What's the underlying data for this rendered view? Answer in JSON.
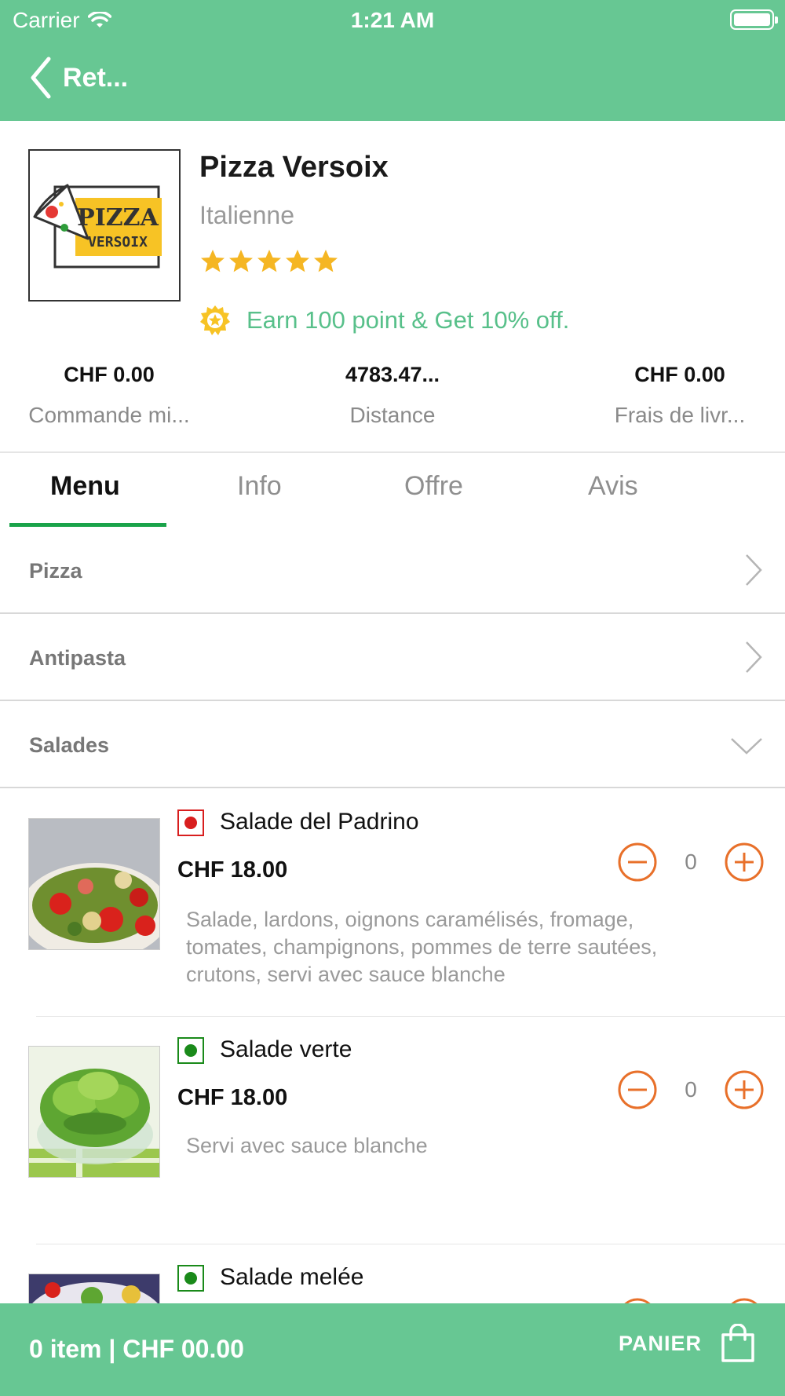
{
  "status_bar": {
    "carrier": "Carrier",
    "time": "1:21 AM"
  },
  "nav": {
    "back_label": "Ret..."
  },
  "restaurant": {
    "name": "Pizza Versoix",
    "cuisine": "Italienne",
    "rating": 5,
    "rating_max": 5,
    "promo": "Earn 100 point & Get 10% off.",
    "logo_text_1": "PIZZA",
    "logo_text_2": "VERSOIX"
  },
  "stats": [
    {
      "value": "CHF 0.00",
      "label": "Commande mi..."
    },
    {
      "value": "4783.47...",
      "label": "Distance"
    },
    {
      "value": "CHF 0.00",
      "label": "Frais de livr..."
    }
  ],
  "tabs": [
    {
      "label": "Menu",
      "active": true
    },
    {
      "label": "Info",
      "active": false
    },
    {
      "label": "Offre",
      "active": false
    },
    {
      "label": "Avis",
      "active": false
    }
  ],
  "categories": [
    {
      "name": "Pizza",
      "expanded": false
    },
    {
      "name": "Antipasta",
      "expanded": false
    },
    {
      "name": "Salades",
      "expanded": true
    }
  ],
  "items": [
    {
      "name": "Salade del Padrino",
      "price": "CHF 18.00",
      "description": "Salade, lardons, oignons caramélisés, fromage, tomates, champignons, pommes de terre sautées, crutons, servi avec sauce blanche",
      "quantity": "0",
      "type": "non-veg"
    },
    {
      "name": "Salade verte",
      "price": "CHF 18.00",
      "description": "Servi avec sauce blanche",
      "quantity": "0",
      "type": "veg"
    },
    {
      "name": "Salade melée",
      "type": "veg"
    }
  ],
  "cart": {
    "summary": "0 item | CHF 00.00",
    "button_label": "PANIER"
  },
  "colors": {
    "brand": "#67c793",
    "accent_orange": "#e8702a",
    "tab_underline": "#1aa34a",
    "star": "#f5b623",
    "veg": "#1a8a1a",
    "non_veg": "#d81e1e"
  }
}
